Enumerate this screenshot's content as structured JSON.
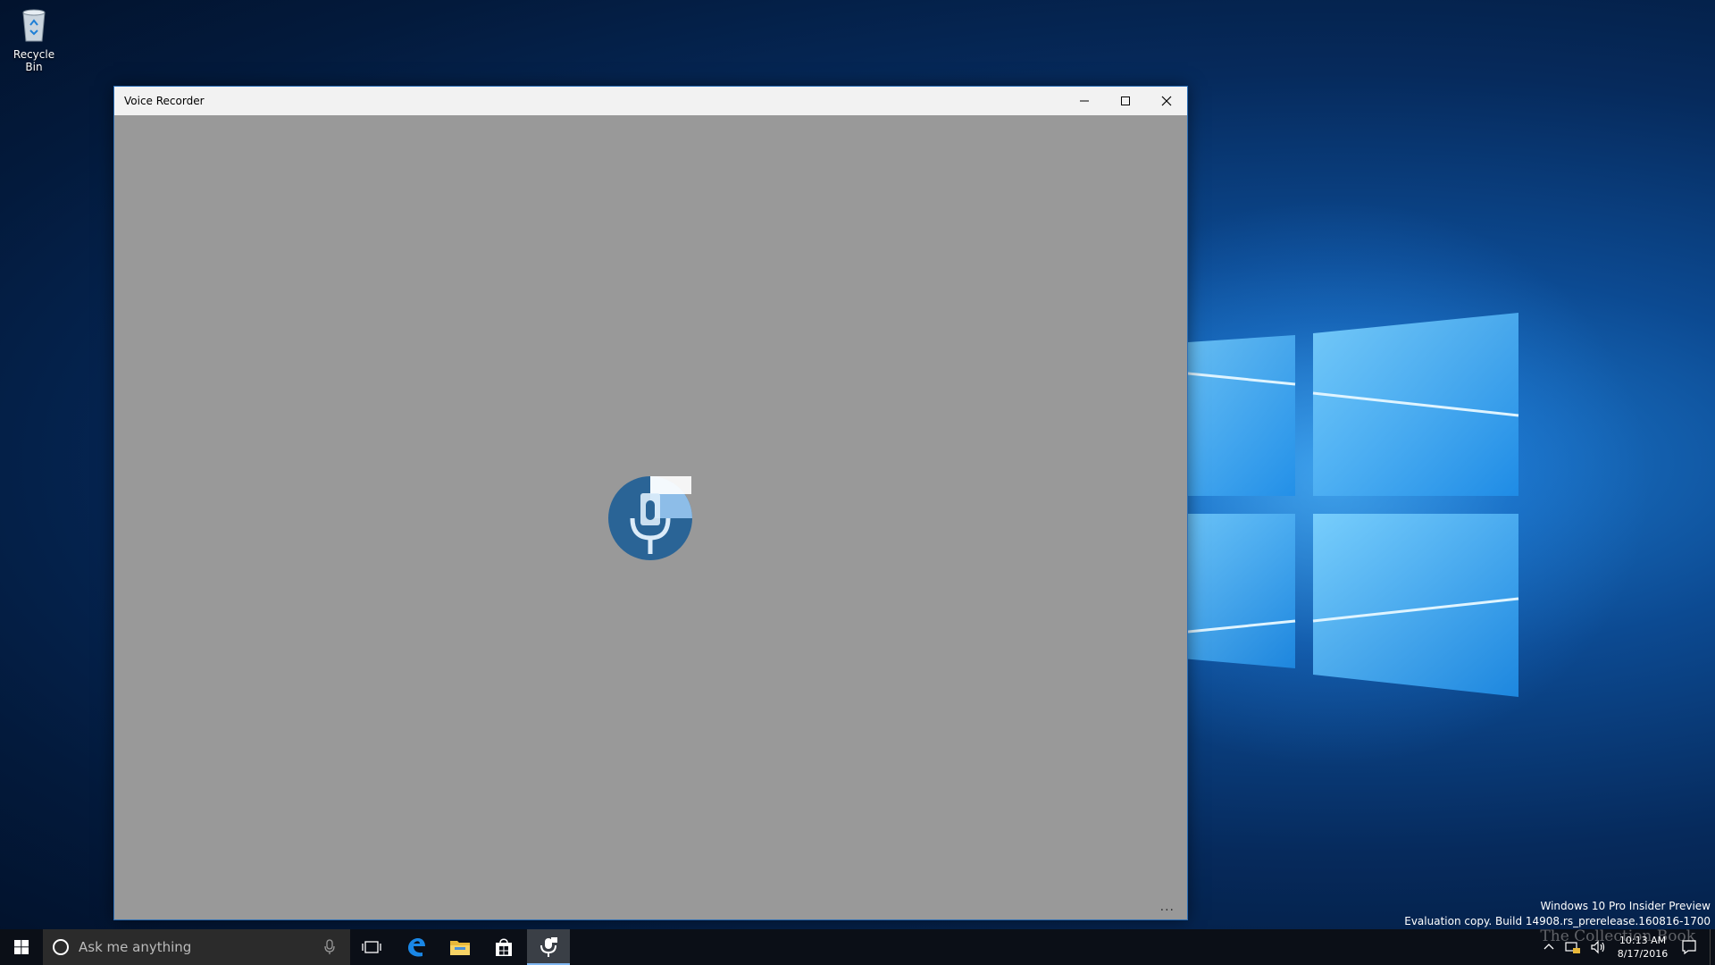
{
  "desktop": {
    "recycle_bin_label": "Recycle Bin"
  },
  "window": {
    "title": "Voice Recorder",
    "minimize_icon": "minimize-icon",
    "maximize_icon": "maximize-icon",
    "close_icon": "close-icon",
    "splash_icon": "microphone-icon",
    "more_label": "..."
  },
  "watermark": {
    "line1": "Windows 10 Pro Insider Preview",
    "line2": "Evaluation copy. Build 14908.rs_prerelease.160816-1700"
  },
  "taskbar": {
    "search_placeholder": "Ask me anything",
    "apps": [
      "task-view-icon",
      "edge-icon",
      "file-explorer-icon",
      "store-icon",
      "voice-recorder-icon"
    ],
    "clock_time": "10:13 AM",
    "clock_date": "8/17/2016",
    "brand_text": "The Collection Book"
  },
  "colors": {
    "window_bg": "#999999",
    "title_bar": "#f2f2f2",
    "taskbar": "#0b0f17",
    "accent": "#2d6fb6"
  }
}
